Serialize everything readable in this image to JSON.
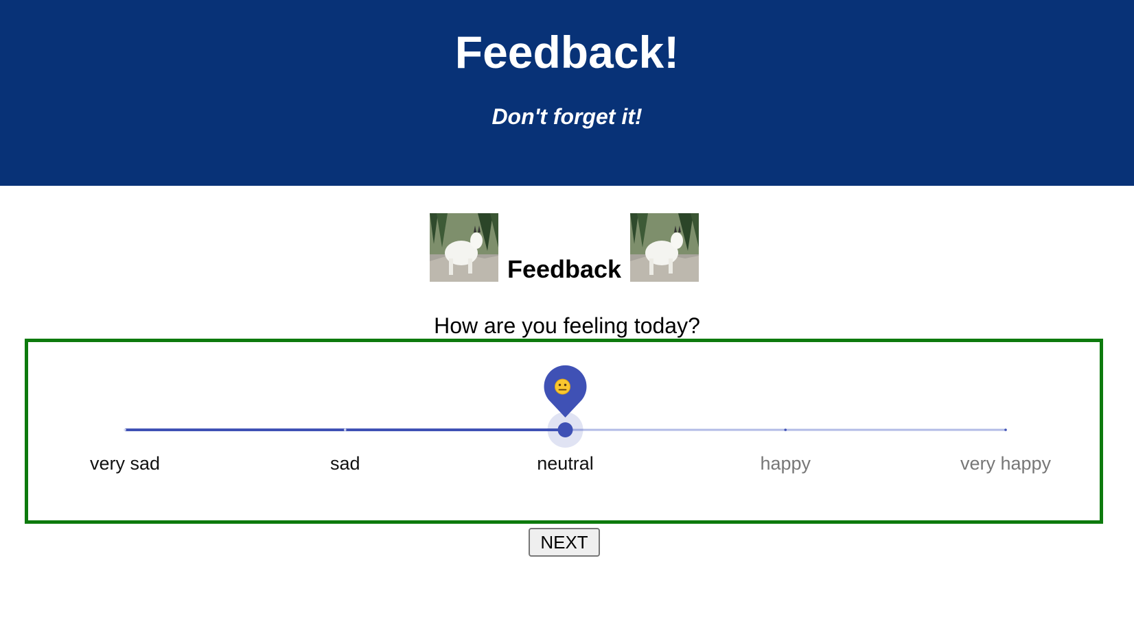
{
  "header": {
    "title": "Feedback!",
    "subtitle": "Don't forget it!",
    "background_color": "#083277"
  },
  "section": {
    "title": "Feedback",
    "image_subject": "mountain-goat"
  },
  "question": "How are you feeling today?",
  "slider": {
    "options": [
      "very sad",
      "sad",
      "neutral",
      "happy",
      "very happy"
    ],
    "selected_index": 2,
    "thumb_emoji_icon": "neutral-face-icon",
    "active_color": "#3f51b5",
    "inactive_color": "#b2bbe6",
    "border_color": "#0d7a0d"
  },
  "next_button": {
    "label": "NEXT"
  }
}
